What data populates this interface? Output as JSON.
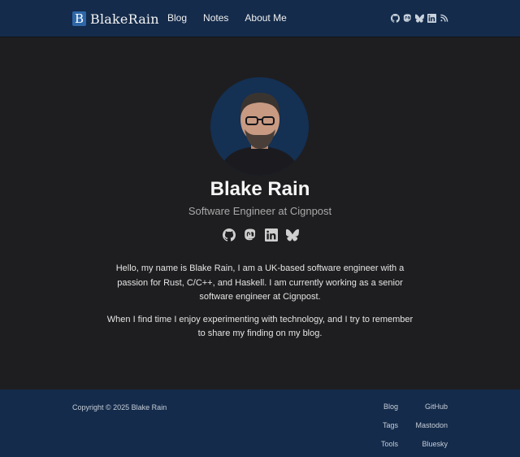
{
  "header": {
    "brand_letter": "B",
    "brand_name": "BlakeRain",
    "nav": [
      "Blog",
      "Notes",
      "About Me"
    ],
    "icons": [
      "github-icon",
      "mastodon-icon",
      "bluesky-icon",
      "linkedin-icon",
      "rss-icon"
    ]
  },
  "profile": {
    "name": "Blake Rain",
    "subtitle": "Software Engineer at Cignpost",
    "social_icons": [
      "github-icon",
      "mastodon-icon",
      "linkedin-icon",
      "bluesky-icon"
    ]
  },
  "bio": {
    "p1": "Hello, my name is Blake Rain, I am a UK-based software engineer with a passion for Rust, C/C++, and Haskell. I am currently working as a senior software engineer at Cignpost.",
    "p2": "When I find time I enjoy experimenting with technology, and I try to remember to share my finding on my blog."
  },
  "footer": {
    "copyright": "Copyright © 2025 Blake Rain",
    "col_a": [
      "Blog",
      "Tags",
      "Tools"
    ],
    "col_b": [
      "GitHub",
      "Mastodon",
      "Bluesky"
    ]
  },
  "colors": {
    "header_bg": "#142b4b",
    "page_bg": "#1e1e20",
    "logo_accent": "#2e67a8"
  }
}
